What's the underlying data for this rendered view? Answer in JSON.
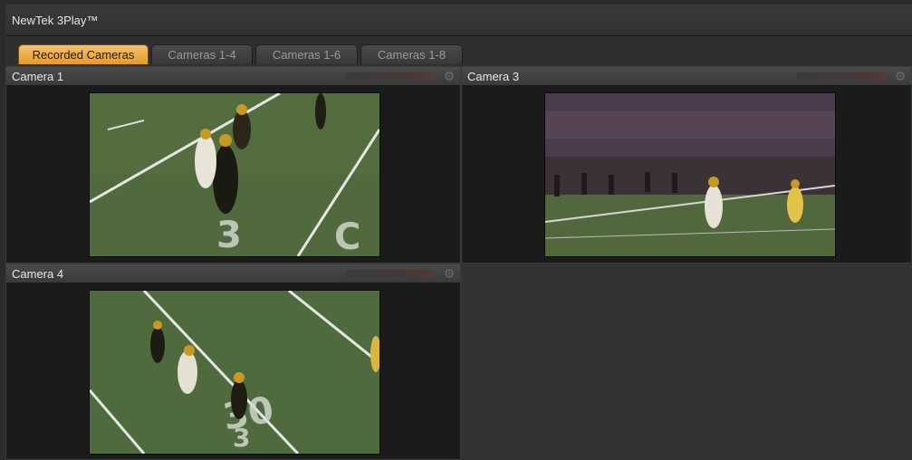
{
  "window": {
    "title": "NewTek 3Play™"
  },
  "tabs": [
    {
      "label": "Recorded Cameras",
      "active": true
    },
    {
      "label": "Cameras 1-4",
      "active": false
    },
    {
      "label": "Cameras 1-6",
      "active": false
    },
    {
      "label": "Cameras 1-8",
      "active": false
    }
  ],
  "panes": [
    {
      "label": "Camera 1",
      "icon": "gear-icon",
      "content": "football play on field, yard marker 30"
    },
    {
      "label": "Camera 3",
      "icon": "gear-icon",
      "content": "wide stadium view with crowd"
    },
    {
      "label": "Camera 4",
      "icon": "gear-icon",
      "content": "overhead field view, yard marker 30"
    }
  ],
  "colors": {
    "accent": "#f0a830",
    "field": "#4f6b3c",
    "background": "#1b1b1b"
  }
}
